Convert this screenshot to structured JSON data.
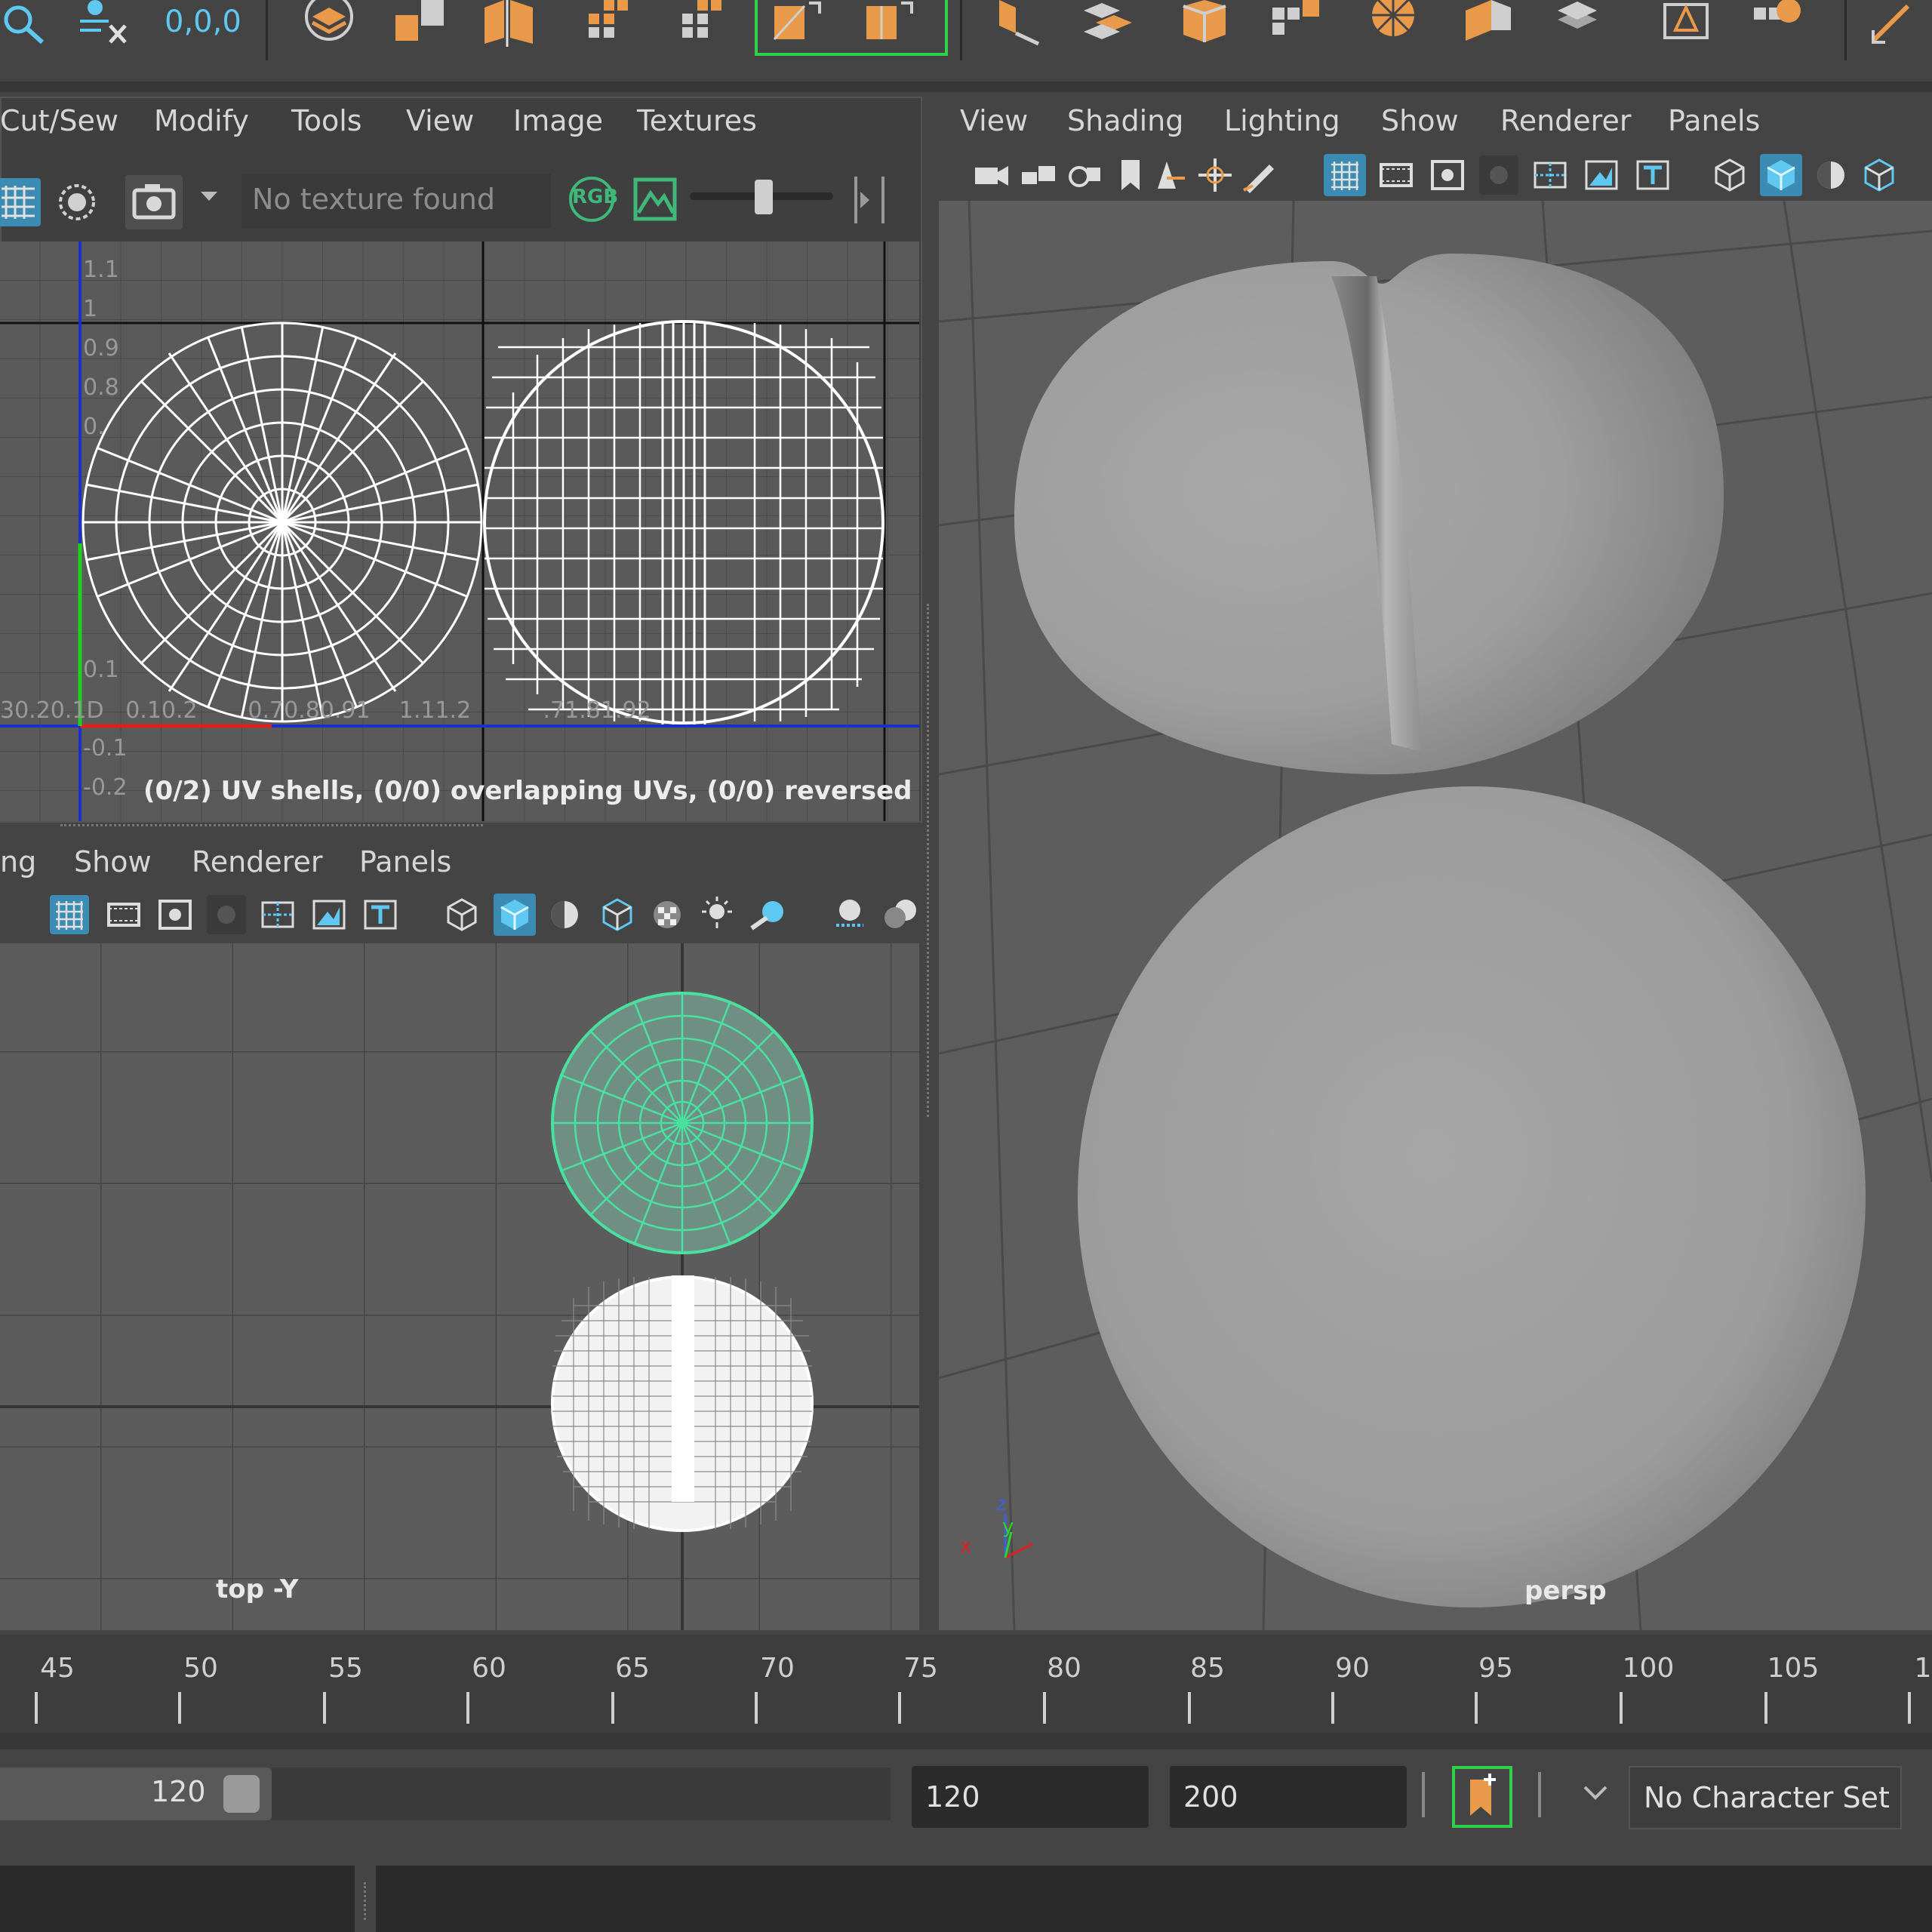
{
  "shelf": {
    "coord_readout": "0,0,0",
    "icons": [
      "camera-search-icon",
      "select-clear-icon",
      "layout-uv-icon",
      "sew-icon",
      "cut-icon",
      "unfold-icon",
      "checker-icon",
      "planar-map-icon",
      "cylindrical-map-icon",
      "spherical-map-icon",
      "auto-map-icon",
      "cube-icon",
      "grid-icon",
      "snap-icon",
      "distort-icon",
      "texel-icon",
      "layout-icon"
    ]
  },
  "uv_editor": {
    "menu": [
      "Cut/Sew",
      "Modify",
      "Tools",
      "View",
      "Image",
      "Textures"
    ],
    "texture_field": "No texture found",
    "rgb_label": "RGB",
    "axis_labels_y": [
      "1.1",
      "1",
      "0.9",
      "0.8",
      "0.",
      "0.1",
      "-0.1",
      "-0.2"
    ],
    "axis_labels_x": "30.20.1D   0.10.2       0.70.80.91    1.11.2          .71.81.92",
    "status": "(0/2) UV shells, (0/0) overlapping UVs, (0/0) reversed UVs"
  },
  "top_panel": {
    "menu": [
      "ng",
      "Show",
      "Renderer",
      "Panels"
    ],
    "camera_label": "top -Y"
  },
  "persp_panel": {
    "menu": [
      "View",
      "Shading",
      "Lighting",
      "Show",
      "Renderer",
      "Panels"
    ],
    "camera_label": "persp",
    "axis": {
      "z": "z",
      "y": "y",
      "x": "x"
    }
  },
  "timeline": {
    "ticks": [
      "45",
      "50",
      "55",
      "60",
      "65",
      "70",
      "75",
      "80",
      "85",
      "90",
      "95",
      "100",
      "105",
      "1"
    ]
  },
  "range": {
    "current_end": "120",
    "start_field": "120",
    "end_field": "200",
    "character_set": "No Character Set"
  },
  "colors": {
    "accent_orange": "#e89a4a",
    "accent_blue": "#5ec8f0",
    "selected_green": "#49e0a0",
    "highlight_blue": "#3b8bb3"
  }
}
